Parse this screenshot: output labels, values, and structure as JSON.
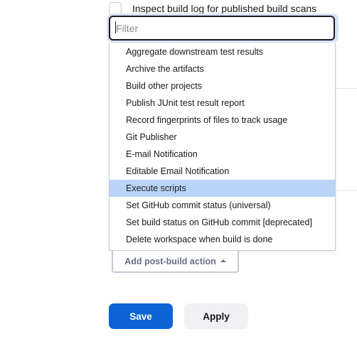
{
  "checkbox": {
    "label": "Inspect build log for published build scans",
    "checked": false
  },
  "filter": {
    "placeholder": "Filter",
    "value": ""
  },
  "menu": {
    "items": [
      {
        "label": "Aggregate downstream test results"
      },
      {
        "label": "Archive the artifacts"
      },
      {
        "label": "Build other projects"
      },
      {
        "label": "Publish JUnit test result report"
      },
      {
        "label": "Record fingerprints of files to track usage"
      },
      {
        "label": "Git Publisher"
      },
      {
        "label": "E-mail Notification"
      },
      {
        "label": "Editable Email Notification"
      },
      {
        "label": "Execute scripts"
      },
      {
        "label": "Set GitHub commit status (universal)"
      },
      {
        "label": "Set build status on GitHub commit [deprecated]"
      },
      {
        "label": "Delete workspace when build is done"
      }
    ],
    "selected_label": "Execute scripts"
  },
  "add_post_build": {
    "label": "Add post-build action",
    "icon": "caret-up-icon"
  },
  "actions": {
    "save_label": "Save",
    "apply_label": "Apply"
  },
  "colors": {
    "primary": "#0c64d6",
    "selected_item": "#b9d4f7",
    "focus_ring": "#d6e3f7"
  }
}
